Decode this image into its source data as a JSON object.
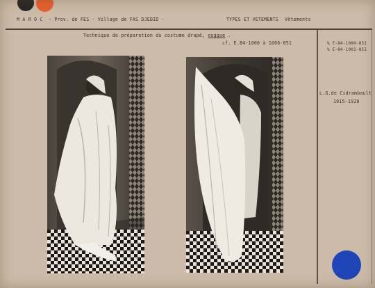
{
  "header": {
    "country": "M A R O C",
    "region": "- Prov. de FES - Village de FAS DJEDID -",
    "category": "TYPES ET VETEMENTS",
    "subcategory": "Vêtements"
  },
  "caption": {
    "line1_prefix": "Technique de préparation du costume drapé,",
    "line1_term": "ouggue",
    "line1_suffix": ".",
    "line2": "cf. E.84-1000 à 1006-851"
  },
  "references": {
    "ref1": "% E-84-1000-851",
    "ref2": "% E-84-1001-851"
  },
  "attribution": {
    "author": "L.G.de Cidrambault",
    "years": "1915-1920"
  },
  "colors": {
    "card": "#cbbba8",
    "ink": "#3b342d",
    "sticker_orange": "#e8602c",
    "sticker_black": "#2a2624",
    "sticker_blue": "#1f45b8"
  }
}
